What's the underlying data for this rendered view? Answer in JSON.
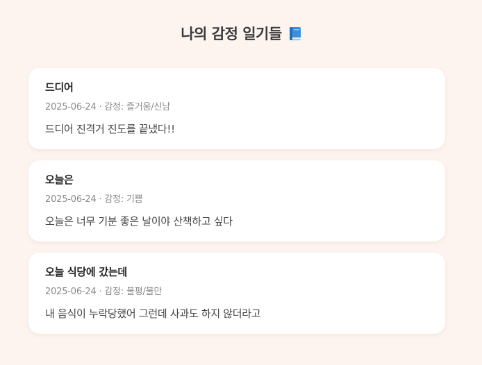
{
  "page": {
    "title": "나의 감정 일기들",
    "title_icon": "blue-book-icon"
  },
  "colors": {
    "background": "#fdf4ef",
    "card": "#ffffff",
    "meta_text": "#8a8a8a",
    "book_icon": "#3b8fd9"
  },
  "entries": [
    {
      "title": "드디어",
      "meta": "2025-06-24 · 감정: 즐거움/신남",
      "content": "드디어 진격거 진도를 끝냈다!!"
    },
    {
      "title": "오늘은",
      "meta": "2025-06-24 · 감정: 기쁨",
      "content": "오늘은 너무 기분 좋은 날이야 산책하고 싶다"
    },
    {
      "title": "오늘 식당에 갔는데",
      "meta": "2025-06-24 · 감정: 불평/불만",
      "content": "내 음식이 누락당했어 그런데 사과도 하지 않더라고"
    }
  ]
}
